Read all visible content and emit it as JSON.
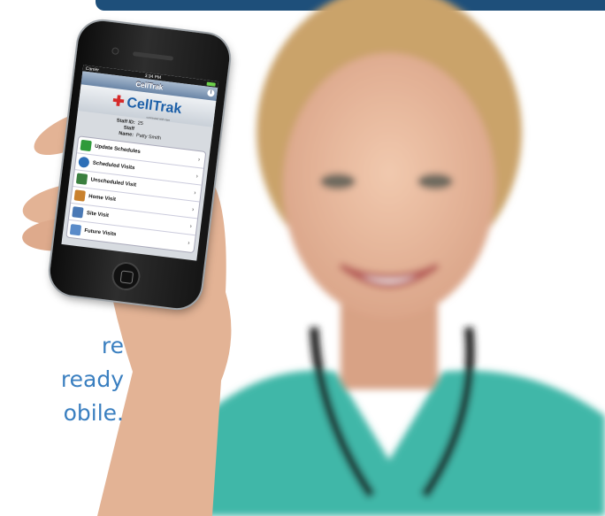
{
  "tagline": [
    "re",
    "ready",
    "obile."
  ],
  "phone": {
    "status": {
      "carrier": "Carrier",
      "time": "3:34 PM"
    },
    "nav_title": "CellTrak",
    "info_symbol": "i",
    "logo_text": "CellTrak",
    "logo_tagline": "connected with care",
    "staff": {
      "id_label": "Staff ID:",
      "id_value": "25",
      "name_label": "Staff Name:",
      "name_value": "Patty Smith"
    },
    "menu": [
      {
        "label": "Update Schedules",
        "icon": "refresh-icon",
        "color": "#2f9a3a"
      },
      {
        "label": "Scheduled Visits",
        "icon": "clock-icon",
        "color": "#2d6fb7"
      },
      {
        "label": "Unscheduled Visit",
        "icon": "pencil-icon",
        "color": "#3b7f3f"
      },
      {
        "label": "Home Visit",
        "icon": "house-icon",
        "color": "#c9812d"
      },
      {
        "label": "Site Visit",
        "icon": "building-icon",
        "color": "#4a79b5"
      },
      {
        "label": "Future Visits",
        "icon": "calendar-clock-icon",
        "color": "#5a8bc9"
      }
    ]
  },
  "colors": {
    "header_bar": "#1e4f7a",
    "tagline": "#3a7fc0",
    "scrubs": "#3fb7a8"
  }
}
